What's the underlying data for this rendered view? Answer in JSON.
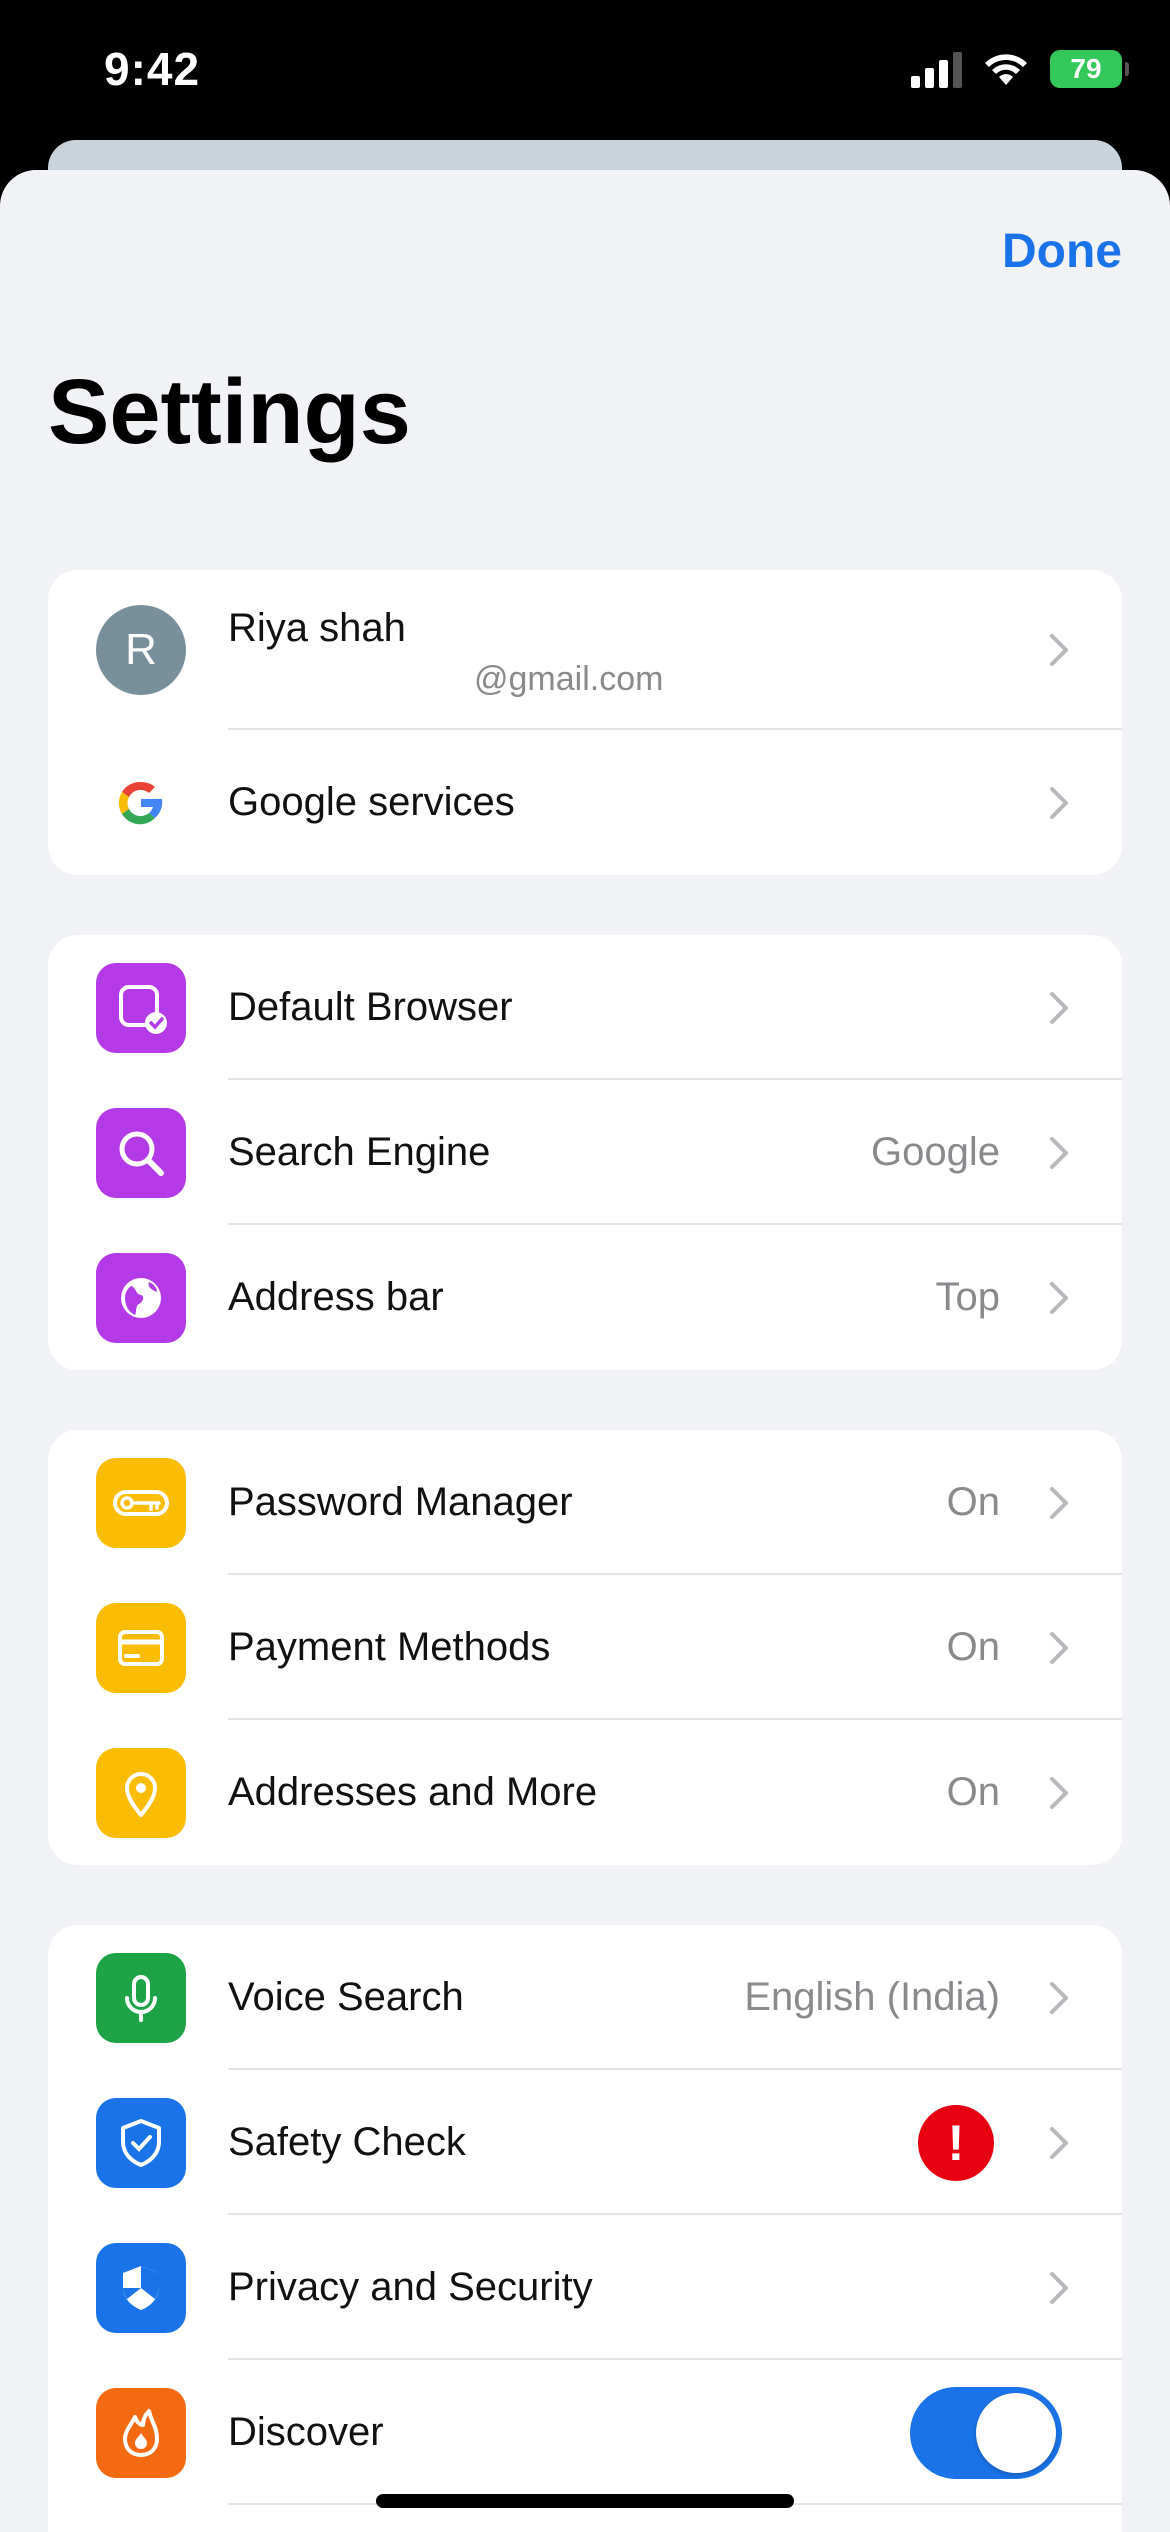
{
  "status": {
    "time": "9:42",
    "battery": "79"
  },
  "header": {
    "done_label": "Done",
    "title": "Settings"
  },
  "profile": {
    "initial": "R",
    "name": "Riya shah",
    "email": "@gmail.com",
    "google_services_label": "Google services"
  },
  "group_browser": [
    {
      "label": "Default Browser",
      "value": "",
      "icon": "default-browser-icon",
      "color": "#b33ae6"
    },
    {
      "label": "Search Engine",
      "value": "Google",
      "icon": "search-icon",
      "color": "#b33ae6"
    },
    {
      "label": "Address bar",
      "value": "Top",
      "icon": "globe-icon",
      "color": "#b33ae6"
    }
  ],
  "group_autofill": [
    {
      "label": "Password Manager",
      "value": "On",
      "icon": "key-icon",
      "color": "#fbbc04"
    },
    {
      "label": "Payment Methods",
      "value": "On",
      "icon": "credit-card-icon",
      "color": "#fbbc04"
    },
    {
      "label": "Addresses and More",
      "value": "On",
      "icon": "location-pin-icon",
      "color": "#fbbc04"
    }
  ],
  "group_other": [
    {
      "label": "Voice Search",
      "value": "English (India)",
      "icon": "microphone-icon",
      "color": "#1ea446"
    },
    {
      "label": "Safety Check",
      "value": "",
      "icon": "shield-check-icon",
      "color": "#1a73e8",
      "badge": "!"
    },
    {
      "label": "Privacy and Security",
      "value": "",
      "icon": "shield-icon",
      "color": "#1a73e8"
    },
    {
      "label": "Discover",
      "value": "",
      "icon": "flame-icon",
      "color": "#f46a11",
      "toggle_on": true
    }
  ]
}
